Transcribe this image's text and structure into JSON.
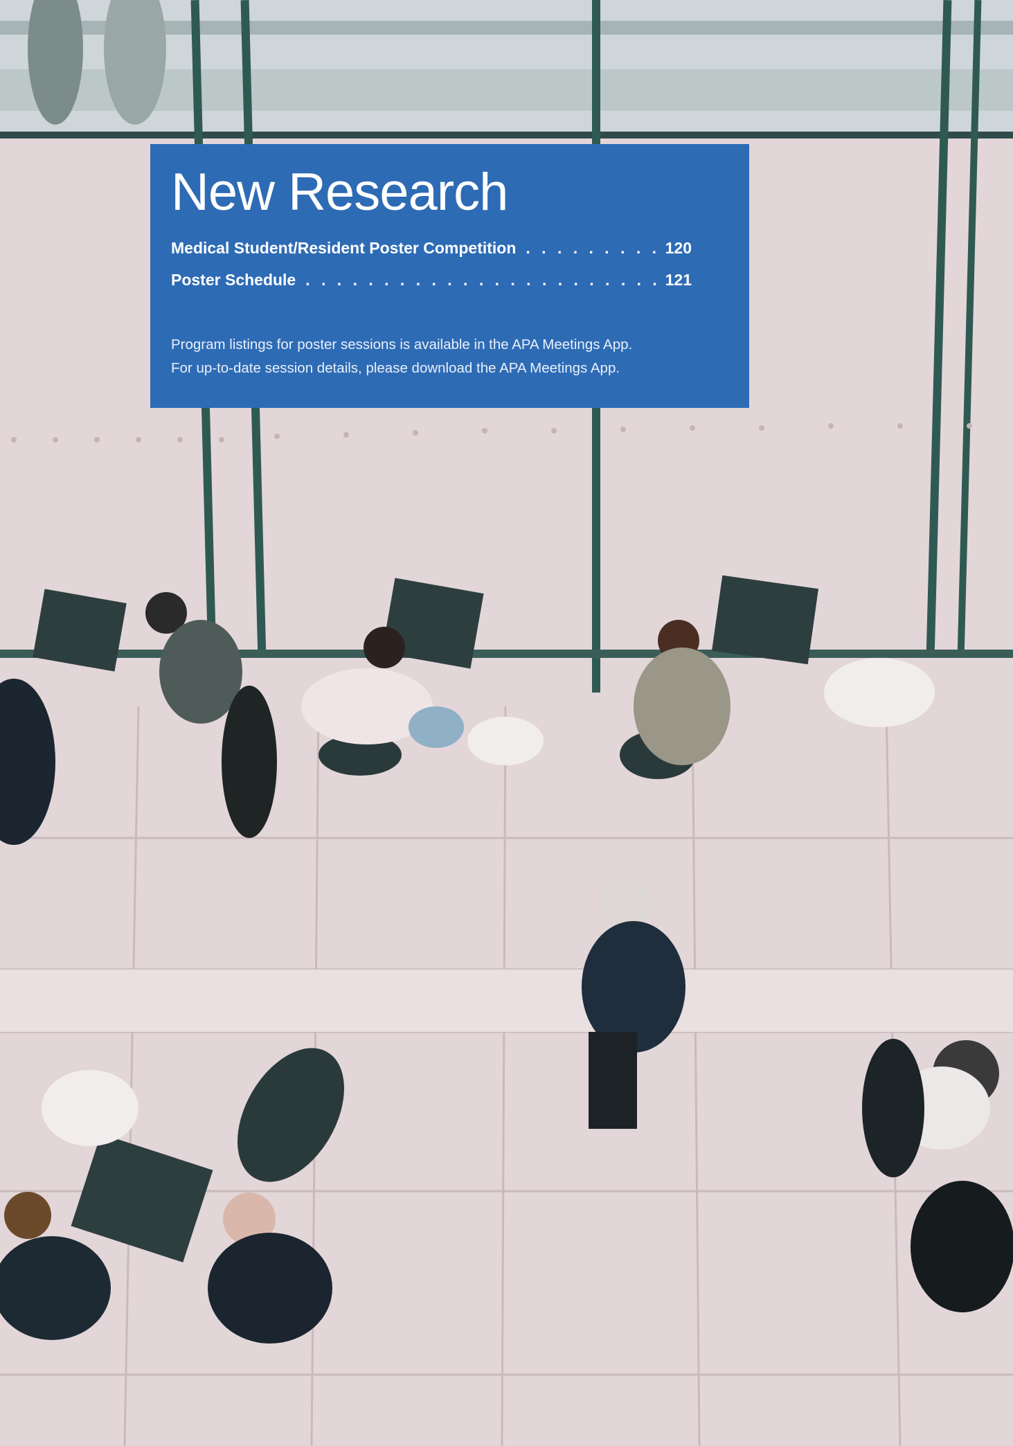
{
  "section": {
    "title": "New Research",
    "toc": [
      {
        "label": "Medical Student/Resident Poster Competition",
        "page": "120"
      },
      {
        "label": "Poster Schedule",
        "page": "121"
      }
    ],
    "note": "Program listings for poster sessions is available in the APA Meetings App. For up-to-date session details, please download the APA Meetings App."
  },
  "colors": {
    "panel": "#2e6bb5",
    "text": "#ffffff",
    "floor": "#e4d8da"
  },
  "background_photo": {
    "subject": "overhead view of people seated at small cafe tables near a glass wall"
  }
}
